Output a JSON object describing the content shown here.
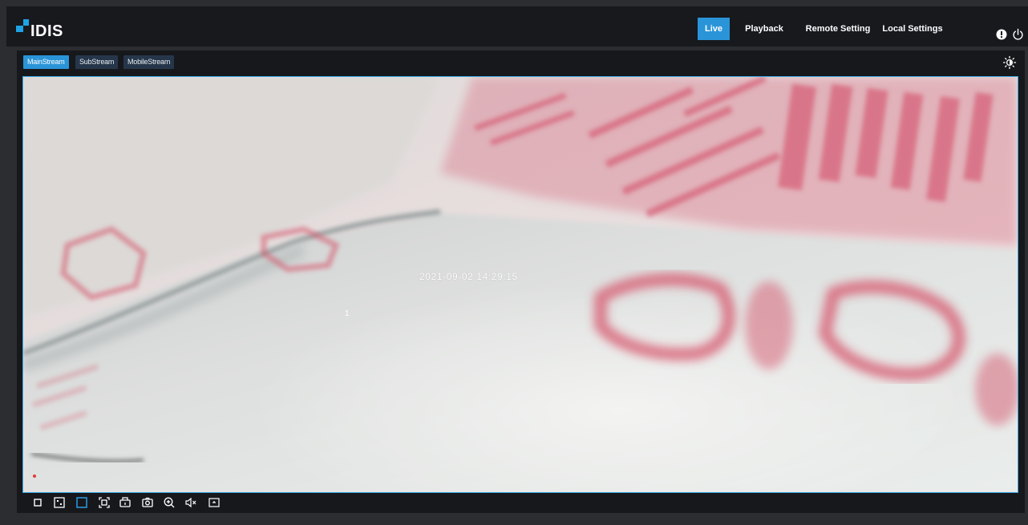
{
  "header": {
    "logo_text": "IDIS",
    "nav": {
      "live": "Live",
      "playback": "Playback",
      "remote_setting": "Remote Setting",
      "local_settings": "Local Settings"
    },
    "icons": [
      "info-icon",
      "power-icon"
    ]
  },
  "streams": {
    "main": "MainStream",
    "sub": "SubStream",
    "mobile": "MobileStream",
    "selected": "MainStream"
  },
  "video": {
    "timestamp": "2021-09-02 14:29:15",
    "channel_number": "1"
  },
  "toolbar": {
    "icons": [
      "single-view-icon",
      "quad-view-icon",
      "fit-window-icon",
      "fullscreen-icon",
      "record-icon",
      "snapshot-icon",
      "zoom-in-icon",
      "mute-icon",
      "overlay-icon"
    ]
  },
  "colors": {
    "accent": "#2a94d8",
    "header_bg": "#17191d",
    "page_bg": "#2b2d31",
    "video_border": "#39a9e4"
  }
}
